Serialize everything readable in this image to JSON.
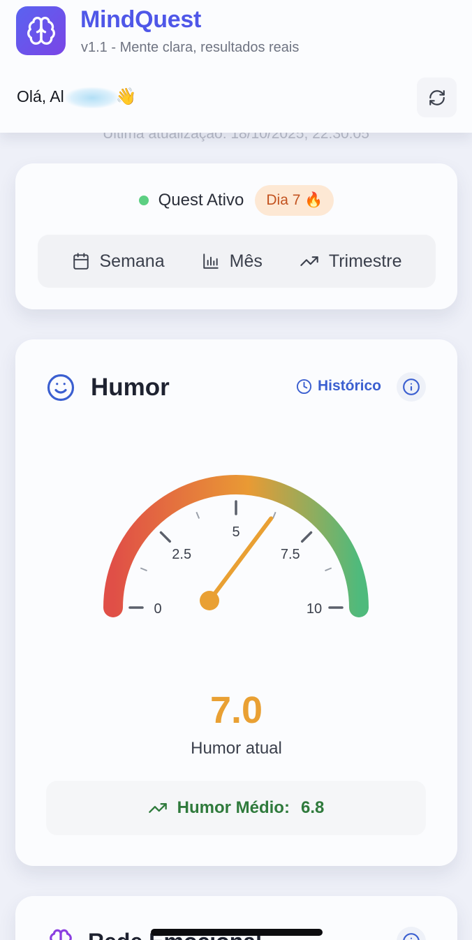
{
  "app": {
    "name": "MindQuest",
    "tagline": "v1.1 - Mente clara, resultados reais"
  },
  "header": {
    "greeting_prefix": "Olá, Al",
    "greeting_emoji": "👋",
    "refresh_icon": "refresh-icon"
  },
  "last_update": "Última atualização: 18/10/2025, 22:30:05",
  "status": {
    "label": "Quest Ativo",
    "status_color": "#5ccf82",
    "day_badge": "Dia 7 🔥"
  },
  "period_tabs": [
    {
      "label": "Semana",
      "icon": "calendar-icon"
    },
    {
      "label": "Mês",
      "icon": "bar-chart-icon"
    },
    {
      "label": "Trimestre",
      "icon": "trending-up-icon"
    }
  ],
  "humor": {
    "title": "Humor",
    "history_label": "Histórico",
    "gauge_min": 0,
    "gauge_max": 10,
    "ticks": [
      "0",
      "2.5",
      "5",
      "7.5",
      "10"
    ],
    "value": 7.0,
    "value_label": "7.0",
    "caption": "Humor atual",
    "average_label": "Humor Médio:",
    "average_value": "6.8",
    "colors": {
      "low": "#e04f47",
      "mid": "#e99a34",
      "high": "#4fba7c",
      "needle": "#e9a033"
    }
  },
  "next_card": {
    "title": "Rede Emocional"
  }
}
